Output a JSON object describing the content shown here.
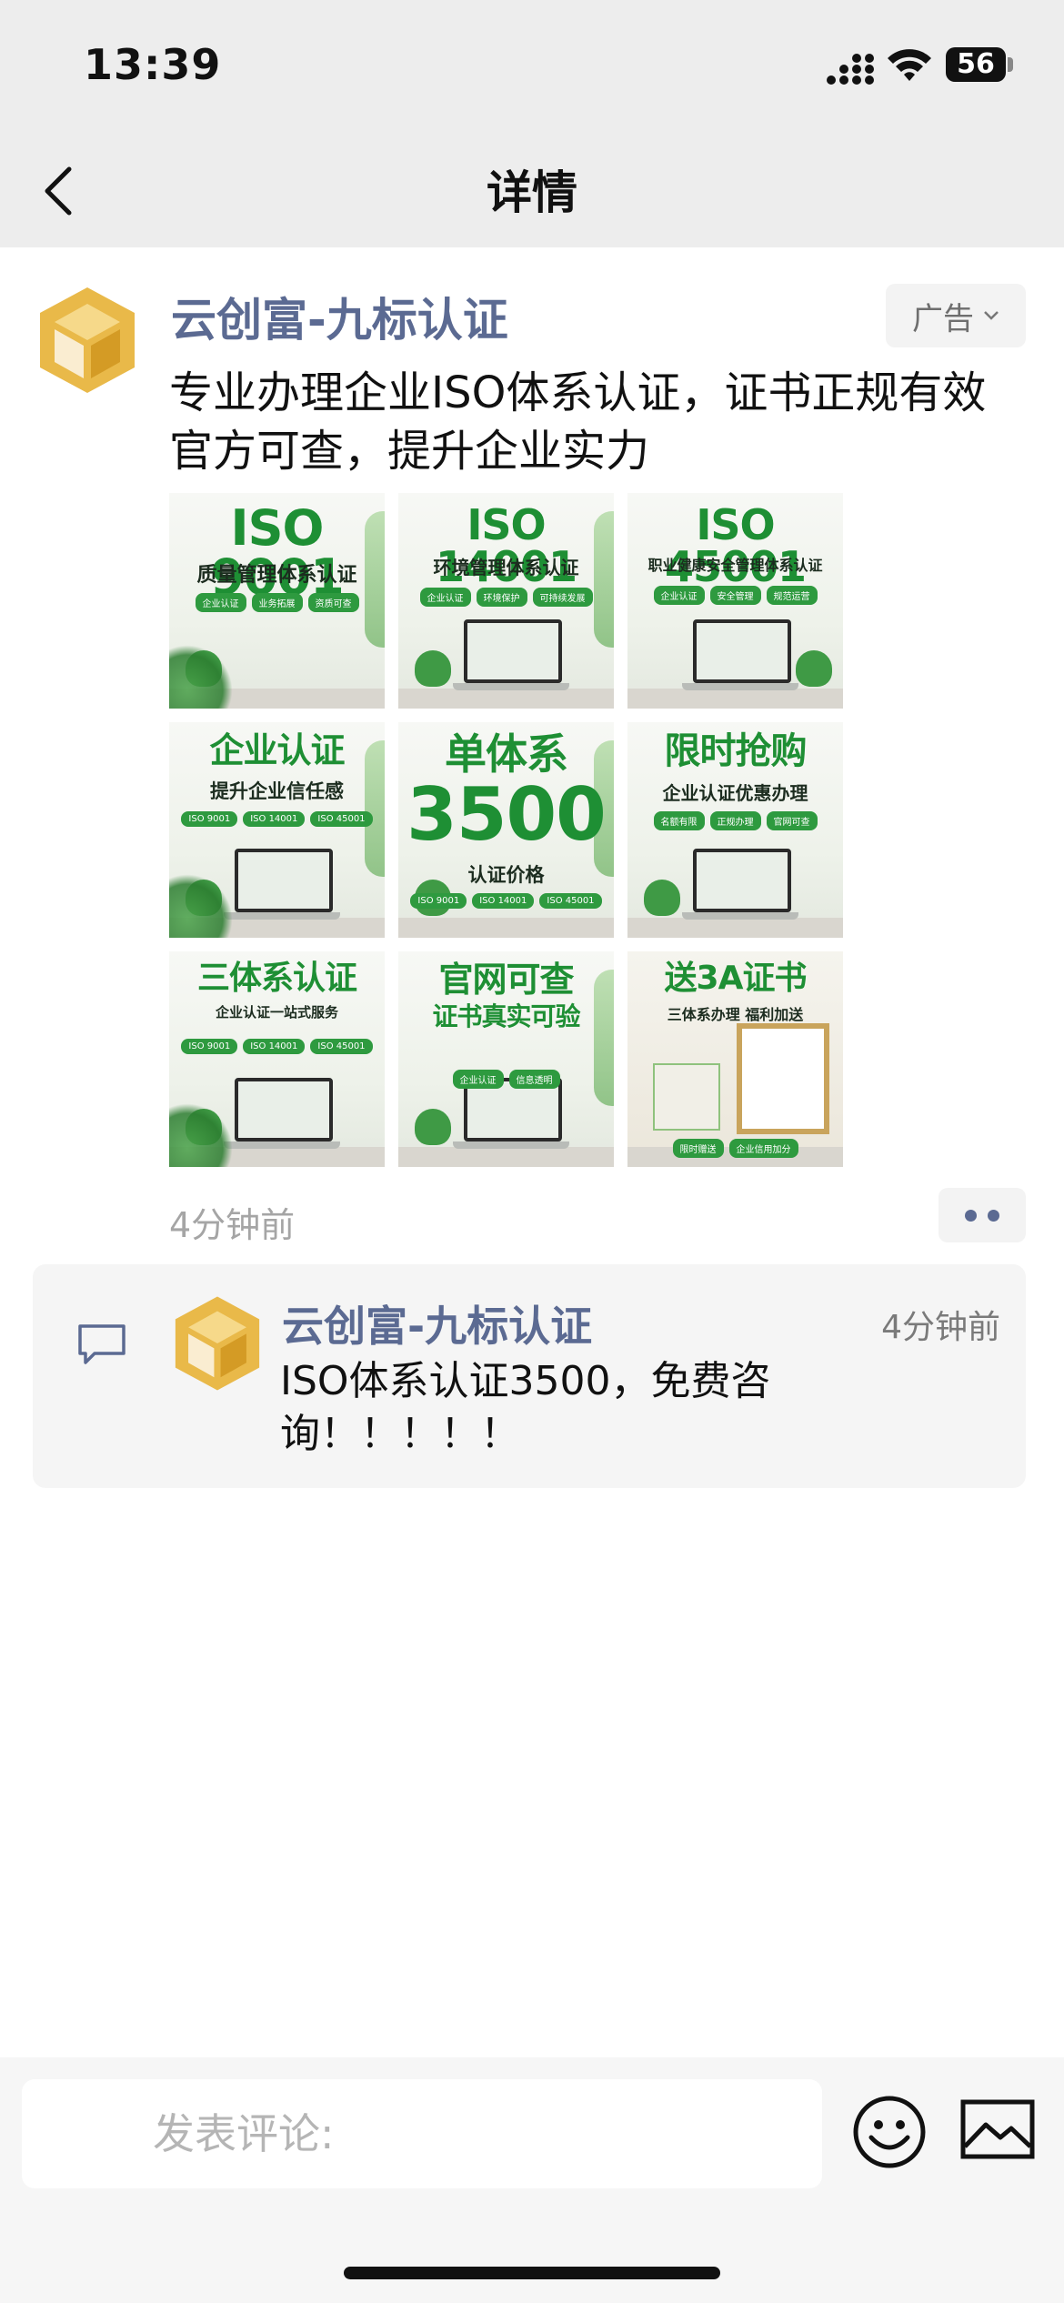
{
  "status_bar": {
    "time": "13:39",
    "battery": "56"
  },
  "nav": {
    "title": "详情",
    "back_icon": "chevron-left-icon"
  },
  "post": {
    "author": "云创富-九标认证",
    "ad_label": "广告",
    "text": "专业办理企业ISO体系认证，证书正规有效官方可查，提升企业实力",
    "time_ago": "4分钟前",
    "images": [
      {
        "headline": "ISO 9001",
        "subline": "质量管理体系认证",
        "chips": [
          "企业认证",
          "业务拓展",
          "资质可查"
        ]
      },
      {
        "headline": "ISO 14001",
        "subline": "环境管理体系认证",
        "chips": [
          "企业认证",
          "环境保护",
          "可持续发展"
        ]
      },
      {
        "headline": "ISO 45001",
        "subline": "职业健康安全管理体系认证",
        "chips": [
          "企业认证",
          "安全管理",
          "规范运营"
        ]
      },
      {
        "headline": "企业认证",
        "subline": "提升企业信任感",
        "chips": [
          "ISO 9001",
          "ISO 14001",
          "ISO 45001"
        ]
      },
      {
        "headline": "单体系",
        "headline2": "3500",
        "subline": "认证价格",
        "chips": [
          "ISO 9001",
          "ISO 14001",
          "ISO 45001"
        ]
      },
      {
        "headline": "限时抢购",
        "subline": "企业认证优惠办理",
        "chips": [
          "名额有限",
          "正规办理",
          "官网可查"
        ]
      },
      {
        "headline": "三体系认证",
        "subline": "企业认证一站式服务",
        "chips": [
          "ISO 9001",
          "ISO 14001",
          "ISO 45001"
        ]
      },
      {
        "headline": "官网可查",
        "subline": "证书真实可验",
        "chips": [
          "企业认证",
          "信息透明"
        ]
      },
      {
        "headline": "送3A证书",
        "subline": "三体系办理 福利加送",
        "chips": [
          "限时赠送",
          "企业信用加分"
        ]
      }
    ]
  },
  "comment": {
    "name": "云创富-九标认证",
    "time": "4分钟前",
    "text": "ISO体系认证3500，免费咨询！！！！！"
  },
  "composer": {
    "placeholder": "发表评论:"
  },
  "colors": {
    "accent_name": "#5b6a92",
    "logo_gold": "#e9b949",
    "tile_green": "#1e8f34"
  }
}
